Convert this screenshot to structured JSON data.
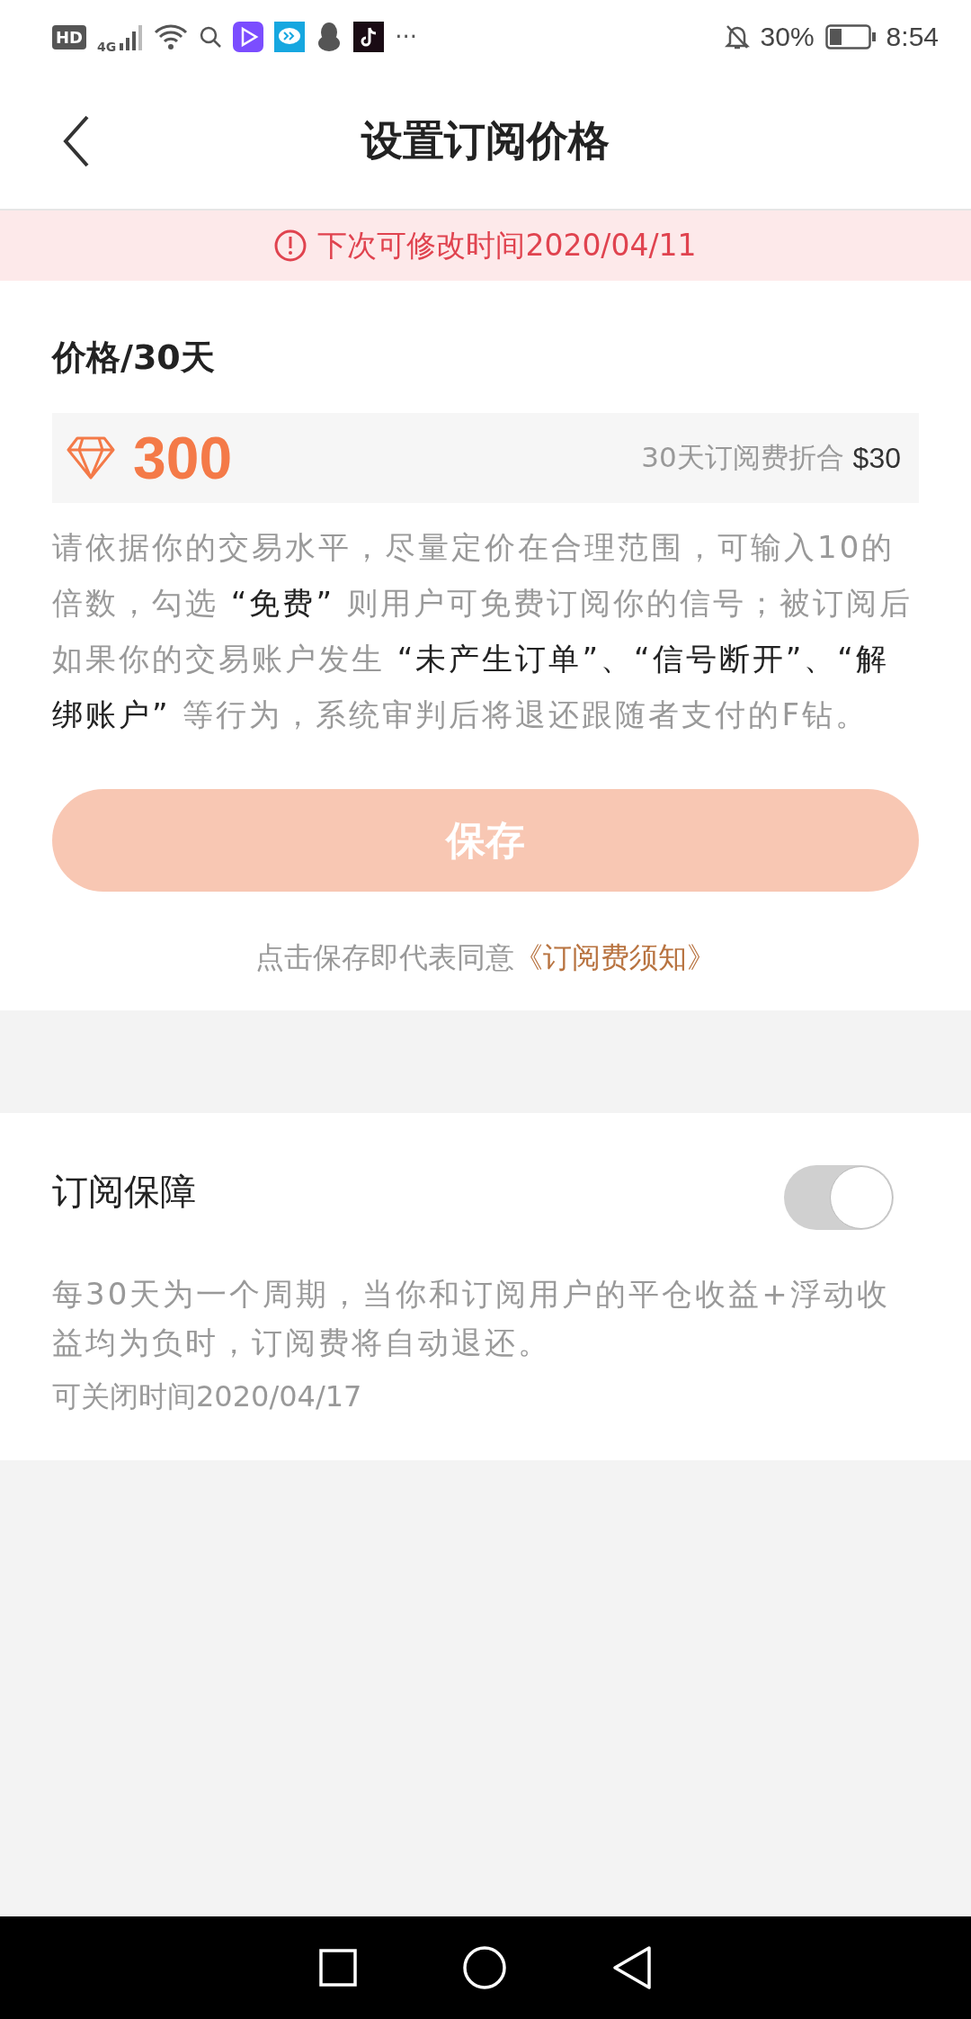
{
  "status_bar": {
    "hd": "HD",
    "network": "4G",
    "battery": "30%",
    "time": "8:54",
    "more": "···"
  },
  "header": {
    "title": "设置订阅价格"
  },
  "notice": {
    "text": "下次可修改时间2020/04/11"
  },
  "price": {
    "label": "价格/30天",
    "value": "300",
    "equivalent": "30天订阅费折合",
    "equivalent_amount": "$30",
    "description": "请依据你的交易水平，尽量定价在合理范围，可输入10的倍数，勾选 **“免费”** 则用户可免费订阅你的信号；被订阅后如果你的交易账户发生 **“未产生订单”、“信号断开”、“解绑账户”** 等行为，系统审判后将退还跟随者支付的F钻。"
  },
  "save_button": {
    "label": "保存",
    "disabled": true
  },
  "agreement": {
    "text": "点击保存即代表同意",
    "link": "《订阅费须知》"
  },
  "protection": {
    "title": "订阅保障",
    "on": true,
    "disabled": true,
    "description": "每30天为一个周期，当你和订阅用户的平仓收益+浮动收益均为负时，订阅费将自动退还。",
    "close_time": "可关闭时间2020/04/17"
  }
}
